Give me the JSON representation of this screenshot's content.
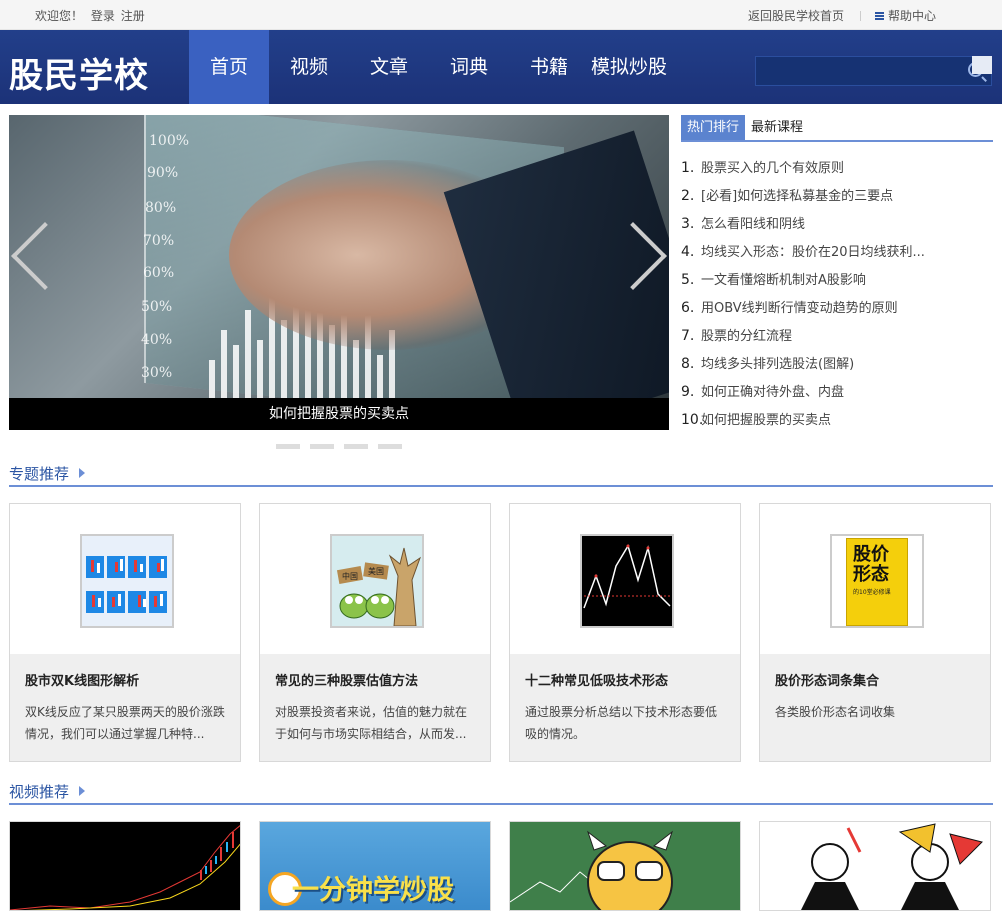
{
  "topbar": {
    "welcome": "欢迎您！",
    "login": "登录",
    "register": "注册",
    "back_home": "返回股民学校首页",
    "help": "帮助中心"
  },
  "header": {
    "logo": "股民学校",
    "nav": [
      "首页",
      "视频",
      "文章",
      "词典",
      "书籍",
      "模拟炒股"
    ],
    "active_nav": "首页",
    "search_placeholder": ""
  },
  "banner": {
    "caption": "如何把握股票的买卖点",
    "chart_ticks": [
      "100%",
      "90%",
      "80%",
      "70%",
      "60%",
      "50%",
      "40%",
      "30%"
    ],
    "slides_count": 4
  },
  "ranking": {
    "tabs": [
      "热门排行",
      "最新课程"
    ],
    "active_tab": "热门排行",
    "items": [
      {
        "num": "1.",
        "text": "股票买入的几个有效原则"
      },
      {
        "num": "2.",
        "text": "[必看]如何选择私募基金的三要点"
      },
      {
        "num": "3.",
        "text": "怎么看阳线和阴线"
      },
      {
        "num": "4.",
        "text": "均线买入形态：股价在20日均线获利..."
      },
      {
        "num": "5.",
        "text": "一文看懂熔断机制对A股影响"
      },
      {
        "num": "6.",
        "text": "用OBV线判断行情变动趋势的原则"
      },
      {
        "num": "7.",
        "text": "股票的分红流程"
      },
      {
        "num": "8.",
        "text": "均线多头排列选股法(图解)"
      },
      {
        "num": "9.",
        "text": "如何正确对待外盘、内盘"
      },
      {
        "num": "10.",
        "text": "如何把握股票的买卖点"
      }
    ]
  },
  "topics": {
    "title": "专题推荐",
    "cards": [
      {
        "title": "股市双K线图形解析",
        "desc": "双K线反应了某只股票两天的股价涨跌情况，我们可以通过掌握几种特..."
      },
      {
        "title": "常见的三种股票估值方法",
        "desc": "对股票投资者来说，估值的魅力就在于如何与市场实际相结合，从而发..."
      },
      {
        "title": "十二种常见低吸技术形态",
        "desc": "通过股票分析总结以下技术形态要低吸的情况。"
      },
      {
        "title": "股价形态词条集合",
        "desc": "各类股价形态名词收集"
      }
    ],
    "thumb_texts": {
      "signs": [
        "中国",
        "美国"
      ],
      "book_title": "股价形态",
      "book_sub": "的10堂必修课"
    }
  },
  "videos": {
    "title": "视频推荐",
    "thumb_text": "一分钟学炒股"
  },
  "colors": {
    "brand": "#1f3a85",
    "nav_active": "#3a61c1",
    "accent_line": "#6c8fd6",
    "section_title": "#2b55a3"
  }
}
